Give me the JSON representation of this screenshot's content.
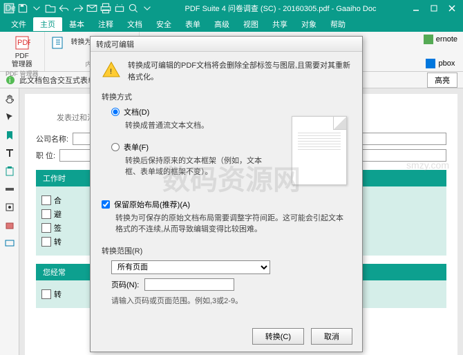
{
  "titlebar": {
    "title": "PDF Suite 4 问卷调查 (SC) - 20160305.pdf - Gaaiho Doc"
  },
  "menu": {
    "file": "文件",
    "home": "主页",
    "basic": "基本",
    "annotate": "注释",
    "document": "文档",
    "security": "安全",
    "form": "表单",
    "advanced": "高级",
    "view": "视图",
    "share": "共享",
    "object": "对象",
    "help": "帮助"
  },
  "ribbon": {
    "group1_btn": "PDF\n管理器",
    "group1_label": "PDF 管理器",
    "group2_btn": "转换为可编辑的PDF",
    "group2_label": "内容",
    "right_item1": "ernote",
    "right_item2": "pbox"
  },
  "infobar": {
    "text": "此文档包含交互式表单域...",
    "highlight": "高亮"
  },
  "document": {
    "faint_line": "发表过和法",
    "company_label": "公司名称:",
    "position_label": "职  位:",
    "section1_header": "工作时",
    "row1": "合",
    "row2": "避",
    "row3": "签",
    "row4": "转",
    "section2_header": "您经常",
    "row5": "转"
  },
  "dialog": {
    "title": "转成可编辑",
    "warning": "转换成可编辑的PDF文档将会删除全部标签与图层,且需要对其重新格式化。",
    "method_label": "转换方式",
    "radio_doc": "文档(D)",
    "radio_doc_desc": "转换成普通流文本文档。",
    "radio_form": "表单(F)",
    "radio_form_desc": "转换后保持原来的文本框架（例如，文本框、表单域的框架不变）。",
    "check_layout": "保留原始布局(推荐)(A)",
    "check_layout_desc": "转换为可保存的原始文档布局需要调整字符间距。这可能会引起文本格式的不连续,从而导致编辑变得比较困难。",
    "range_label": "转换范围(R)",
    "range_select": "所有页面",
    "page_label": "页码(N):",
    "page_hint": "请输入页码或页面范围。例如,3或2-9。",
    "btn_convert": "转换(C)",
    "btn_cancel": "取消"
  },
  "watermark": {
    "main": "数码资源网",
    "sub": "smzy.com"
  }
}
